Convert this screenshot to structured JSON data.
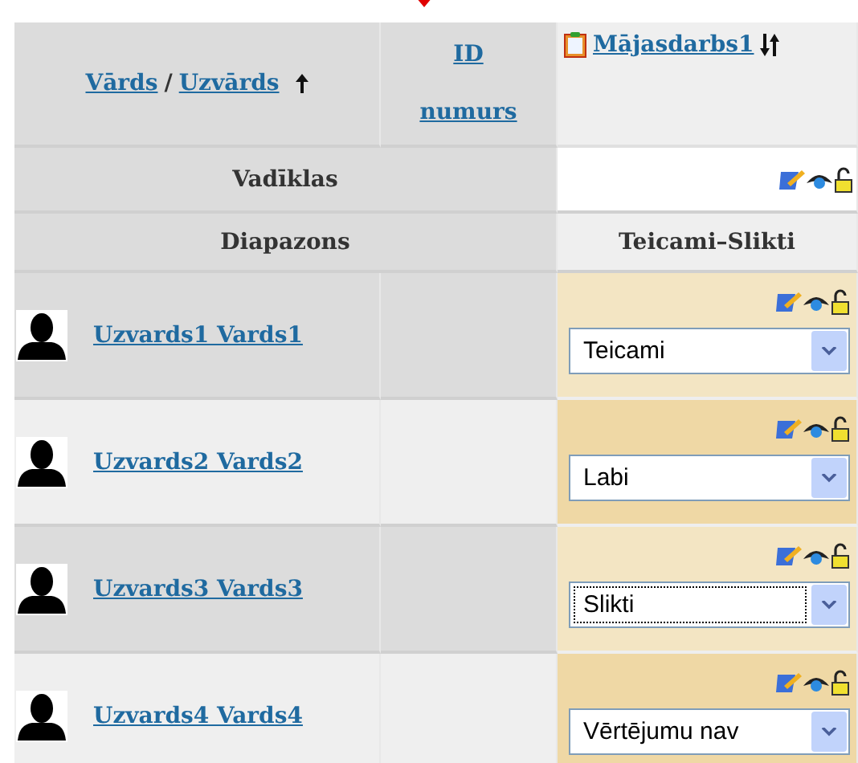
{
  "header": {
    "name_sort": [
      {
        "label": "Vārds"
      },
      {
        "label": "Uzvārds"
      }
    ],
    "separator": "/",
    "id_column": "ID numurs",
    "assignment": "Mājasdarbs1"
  },
  "controls_row": {
    "label": "Vadīklas"
  },
  "range_row": {
    "label": "Diapazons",
    "value": "Teicami–Slikti"
  },
  "students": [
    {
      "name": "Uzvards1 Vards1",
      "grade": "Teicami",
      "focused": false
    },
    {
      "name": "Uzvards2 Vards2",
      "grade": "Labi",
      "focused": false
    },
    {
      "name": "Uzvards3 Vards3",
      "grade": "Slikti",
      "focused": true
    },
    {
      "name": "Uzvards4 Vards4",
      "grade": "Vērtējumu nav",
      "focused": false
    }
  ]
}
